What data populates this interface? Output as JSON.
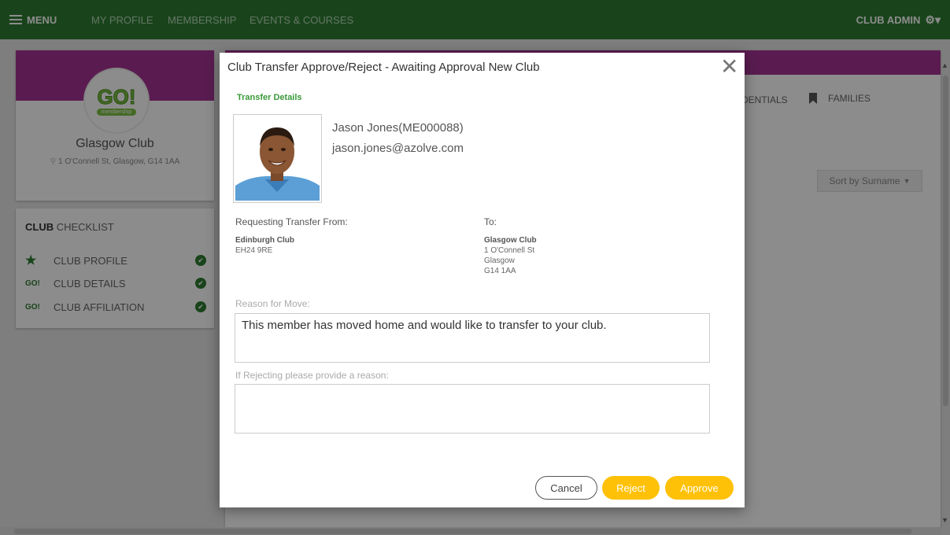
{
  "topbar": {
    "menu_label": "MENU",
    "links": [
      "MY PROFILE",
      "MEMBERSHIP",
      "EVENTS & COURSES"
    ],
    "admin_label": "CLUB ADMIN",
    "colors": {
      "bar": "#2e7d32"
    }
  },
  "club_card": {
    "logo_text": "GO!",
    "logo_sub": "membership",
    "name": "Glasgow Club",
    "address": "1 O'Connell St, Glasgow, G14 1AA"
  },
  "checklist": {
    "title_bold": "CLUB",
    "title_rest": " CHECKLIST",
    "items": [
      {
        "icon": "star-icon",
        "label": "CLUB PROFILE",
        "done": true
      },
      {
        "icon": "go-icon",
        "icon_text": "GO!",
        "label": "CLUB DETAILS",
        "done": true
      },
      {
        "icon": "go-icon",
        "icon_text": "GO!",
        "label": "CLUB AFFILIATION",
        "done": true
      }
    ]
  },
  "main": {
    "tabs": [
      "DENTIALS",
      "FAMILIES"
    ],
    "sort_label": "Sort by Surname"
  },
  "modal": {
    "title": "Club Transfer Approve/Reject - Awaiting Approval New Club",
    "close_glyph": "✕",
    "section_label": "Transfer Details",
    "member": {
      "name": "Jason Jones(ME000088)",
      "email": "jason.jones@azolve.com"
    },
    "from": {
      "label": "Requesting Transfer From:",
      "club": "Edinburgh Club",
      "lines": [
        "EH24 9RE"
      ]
    },
    "to": {
      "label": "To:",
      "club": "Glasgow Club",
      "lines": [
        "1 O'Connell St",
        "Glasgow",
        "G14 1AA"
      ]
    },
    "reason": {
      "label": "Reason for Move:",
      "value": "This member has moved home and would like to transfer to your club."
    },
    "reject_reason": {
      "label": "If Rejecting please provide a reason:",
      "value": ""
    },
    "buttons": {
      "cancel": "Cancel",
      "reject": "Reject",
      "approve": "Approve"
    },
    "colors": {
      "accent": "#ffc107",
      "section": "#3a9a3a"
    }
  },
  "colors": {
    "banner": "#a53492",
    "overlay": "rgba(0,0,0,0.45)"
  }
}
